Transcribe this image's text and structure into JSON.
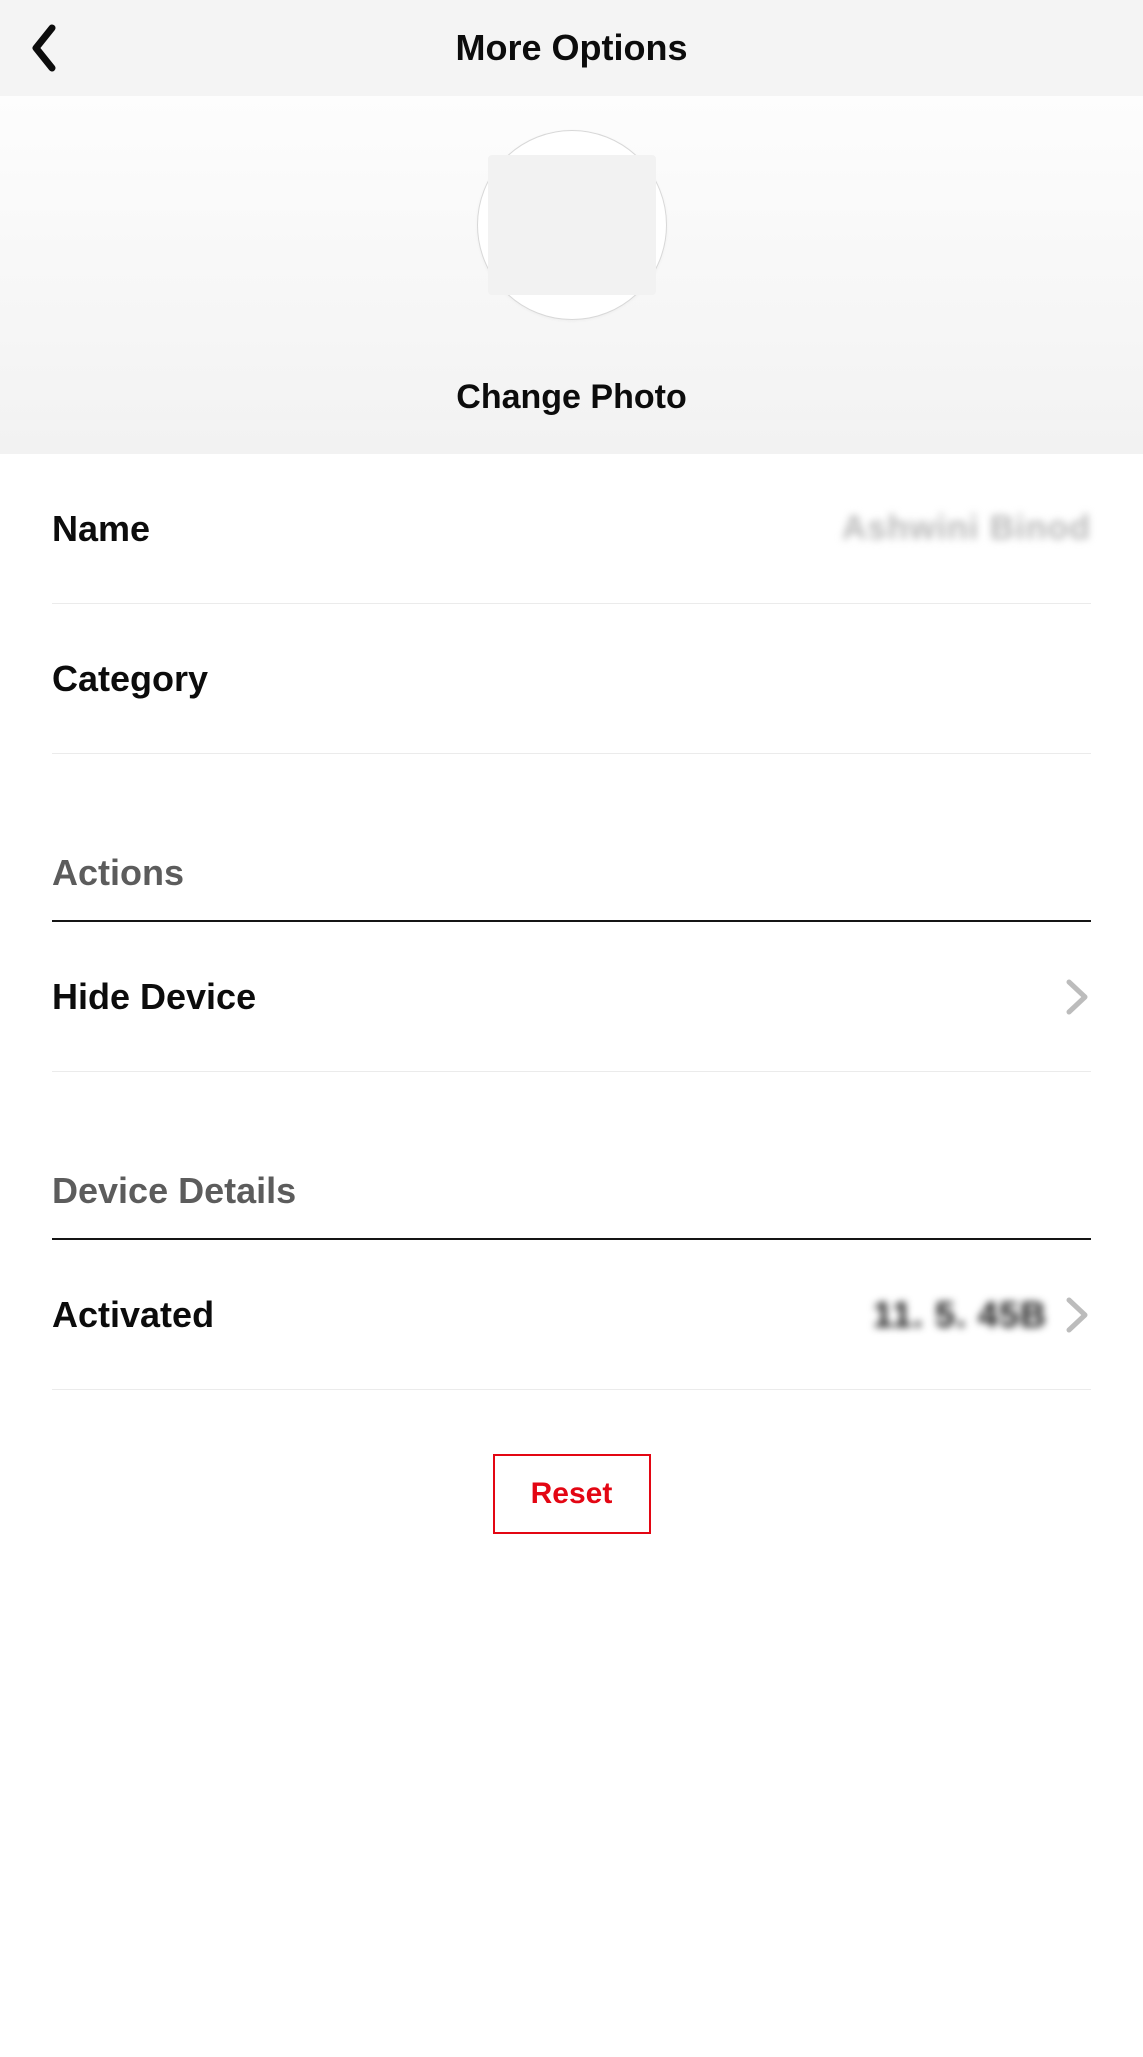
{
  "header": {
    "title": "More Options"
  },
  "photo": {
    "change_label": "Change Photo"
  },
  "fields": {
    "name_label": "Name",
    "name_value": "Ashwini Binod",
    "category_label": "Category",
    "category_value": ""
  },
  "sections": {
    "actions": {
      "heading": "Actions",
      "hide_device_label": "Hide Device"
    },
    "device_details": {
      "heading": "Device Details",
      "activated_label": "Activated",
      "activated_value": "11. 5. 45B"
    }
  },
  "buttons": {
    "reset_label": "Reset"
  }
}
